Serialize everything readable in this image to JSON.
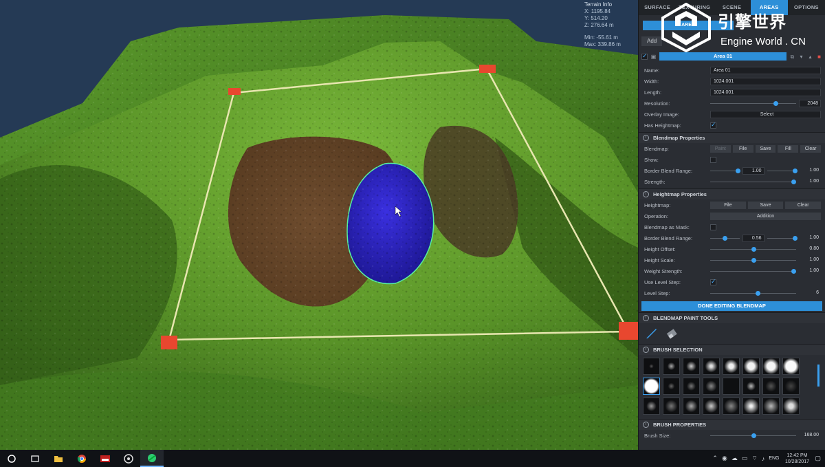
{
  "terrain_info": {
    "title": "Terrain Info",
    "x": "X: 1195.84",
    "y": "Y: 514.20",
    "z": "Z: 276.64 m",
    "min": "Min: -55.61 m",
    "max": "Max: 339.86 m"
  },
  "tabs": [
    "SURFACE",
    "TEXTURING",
    "SCENE",
    "AREAS",
    "OPTIONS"
  ],
  "areas_button": "AREA",
  "add_label": "Add",
  "area": {
    "name_bar": "Area 01",
    "name": "Area 01",
    "width": "1024.001",
    "length": "1024.001",
    "resolution": "2048",
    "overlay_button": "Select"
  },
  "labels": {
    "name": "Name:",
    "width": "Width:",
    "length": "Length:",
    "resolution": "Resolution:",
    "overlay": "Overlay Image:",
    "has_heightmap": "Has Heightmap:"
  },
  "blendmap": {
    "section": "Blendmap Properties",
    "blendmap_label": "Blendmap:",
    "buttons": [
      "Paint",
      "File",
      "Save",
      "Fill",
      "Clear"
    ],
    "show_label": "Show:",
    "border_label": "Border Blend Range:",
    "border_a": "1.00",
    "border_b": "1.00",
    "strength_label": "Strength:",
    "strength": "1.00"
  },
  "heightmap": {
    "section": "Heightmap Properties",
    "heightmap_label": "Heightmap:",
    "buttons": [
      "File",
      "Save",
      "Clear"
    ],
    "operation_label": "Operation:",
    "operation": "Addition",
    "mask_label": "Blendmap as Mask:",
    "border_label": "Border Blend Range:",
    "border_a": "0.56",
    "border_b": "1.00",
    "offset_label": "Height Offset:",
    "offset": "0.80",
    "scale_label": "Height Scale:",
    "scale": "1.00",
    "weight_label": "Weight Strength:",
    "weight": "1.00",
    "use_level_label": "Use Level Step:",
    "level_label": "Level Step:",
    "level": "6"
  },
  "done_button": "DONE EDITING BLENDMAP",
  "paint_tools_section": "BLENDMAP PAINT TOOLS",
  "brush_selection_section": "BRUSH SELECTION",
  "brush_properties_section": "BRUSH PROPERTIES",
  "brush_size_label": "Brush Size:",
  "brush_size": "168.00",
  "watermark": {
    "cn": "引擎世界",
    "en": "Engine World . CN"
  },
  "taskbar": {
    "lang": "ENG",
    "time": "12:42 PM",
    "date": "10/28/2017"
  },
  "colors": {
    "accent": "#2d8fd8",
    "terrain_green": "#5e9a2a",
    "dirt_brown": "#6e4a2c",
    "water_blue": "#2a22c8",
    "marker_red": "#e8472f"
  }
}
